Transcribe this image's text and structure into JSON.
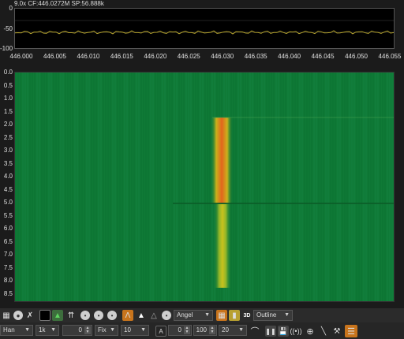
{
  "status": {
    "info": "9.0x CF:446.0272M SP:56.888k"
  },
  "spectrum": {
    "y_labels": [
      "0",
      "-50",
      "-100"
    ],
    "freq_labels": [
      "446.000",
      "446.005",
      "446.010",
      "446.015",
      "446.020",
      "446.025",
      "446.030",
      "446.035",
      "446.040",
      "446.045",
      "446.050",
      "446.055"
    ]
  },
  "waterfall": {
    "time_labels": [
      "0.0",
      "0.5",
      "1.0",
      "1.5",
      "2.0",
      "2.5",
      "3.0",
      "3.5",
      "4.0",
      "4.5",
      "5.0",
      "5.5",
      "6.0",
      "6.5",
      "7.0",
      "7.5",
      "8.0",
      "8.5"
    ]
  },
  "colors": {
    "waterfall_bg": "#0f7a36",
    "signal_core": "#e2641c",
    "signal_edge": "#c9b21c",
    "trace": "#b9a72e",
    "accent_orange": "#c8741c"
  },
  "toolbar1": {
    "icons": [
      "grid-icon",
      "circle-icon",
      "cross-icon",
      "black-square-icon",
      "green-peak-icon",
      "antenna-icon",
      "circle-icon",
      "circle-icon",
      "circle-icon",
      "peak-orange-icon",
      "peak-white-icon",
      "peak-grey-icon",
      "circle-icon"
    ],
    "palette_select": "Angel",
    "mode_icons": [
      "grid-orange-icon",
      "bars-icon",
      "3d-icon"
    ],
    "three_d_label": "3D",
    "outline_select": "Outline"
  },
  "toolbar2": {
    "window_select": "Han",
    "fft_select": "1k",
    "offset_value": "0",
    "scale_select": "Fix",
    "ref_select": "10",
    "a_label": "A",
    "a_value": "0",
    "range_value": "100",
    "avg_select": "20",
    "buttons": [
      "curve-icon",
      "pause-icon",
      "save-icon",
      "broadcast-icon",
      "target-icon",
      "ruler-icon",
      "wrench-icon",
      "menu-icon"
    ]
  }
}
